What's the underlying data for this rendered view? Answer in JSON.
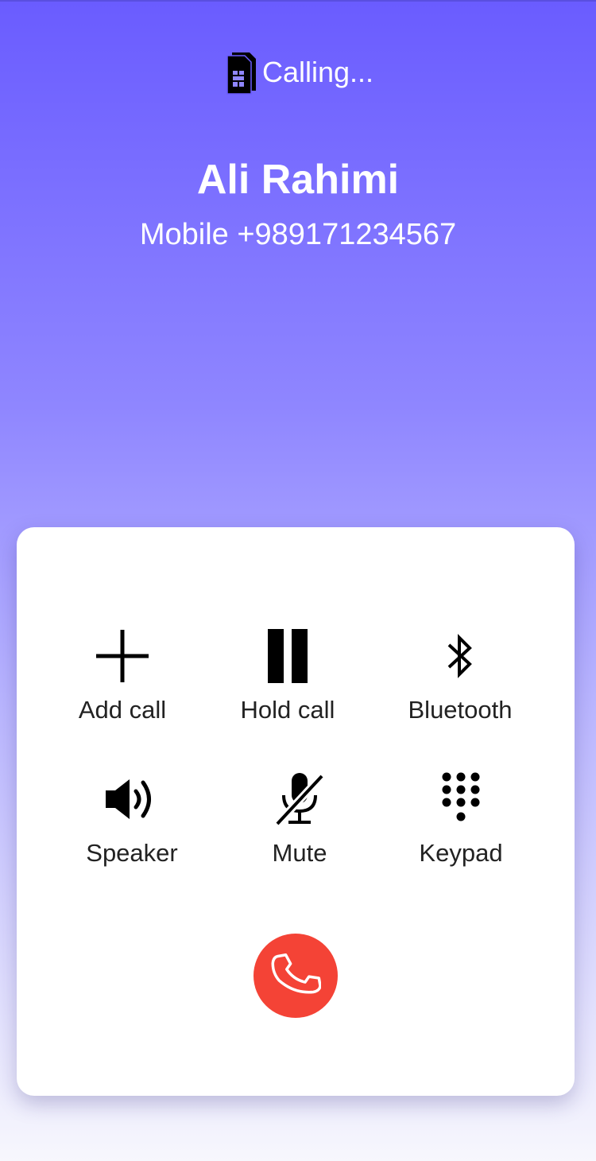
{
  "status": {
    "sim_icon": "sim-card-icon",
    "text": "Calling..."
  },
  "contact": {
    "name": "Ali Rahimi",
    "number": "Mobile +989171234567"
  },
  "controls": [
    {
      "label": "Add call",
      "icon": "plus-icon"
    },
    {
      "label": "Hold call",
      "icon": "pause-icon"
    },
    {
      "label": "Bluetooth",
      "icon": "bluetooth-icon"
    },
    {
      "label": "Speaker",
      "icon": "speaker-icon"
    },
    {
      "label": "Mute",
      "icon": "mic-off-icon"
    },
    {
      "label": "Keypad",
      "icon": "dialpad-icon"
    }
  ],
  "end_call": {
    "icon": "phone-hangup-icon",
    "color": "#f44336"
  },
  "colors": {
    "gradient_top": "#6a5cff",
    "panel": "#ffffff",
    "text_on_gradient": "#ffffff"
  }
}
